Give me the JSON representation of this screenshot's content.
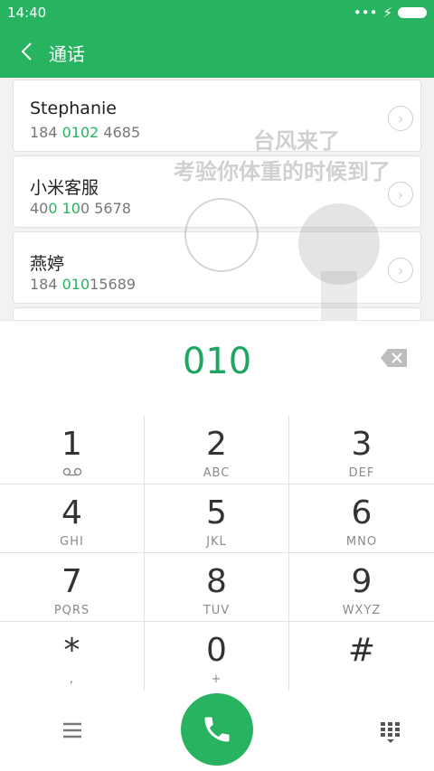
{
  "status_bar": {
    "time": "14:40"
  },
  "app_bar": {
    "title": "通话"
  },
  "contacts": [
    {
      "name": "Stephanie",
      "number_parts": [
        "184 ",
        "0102",
        " 4685"
      ]
    },
    {
      "name": "小米客服",
      "number_parts": [
        "40",
        "0 10",
        "0 5678"
      ]
    },
    {
      "name": "燕婷",
      "number_parts": [
        "184 ",
        "010",
        "15689"
      ]
    }
  ],
  "watermark": {
    "line1": "台风来了",
    "line2": "考验你体重的时候到了"
  },
  "dialer": {
    "entered_number": "010"
  },
  "keypad": {
    "keys": [
      {
        "digit": "1",
        "letters": ""
      },
      {
        "digit": "2",
        "letters": "ABC"
      },
      {
        "digit": "3",
        "letters": "DEF"
      },
      {
        "digit": "4",
        "letters": "GHI"
      },
      {
        "digit": "5",
        "letters": "JKL"
      },
      {
        "digit": "6",
        "letters": "MNO"
      },
      {
        "digit": "7",
        "letters": "PQRS"
      },
      {
        "digit": "8",
        "letters": "TUV"
      },
      {
        "digit": "9",
        "letters": "WXYZ"
      },
      {
        "digit": "*",
        "letters": ","
      },
      {
        "digit": "0",
        "letters": "+"
      },
      {
        "digit": "#",
        "letters": ""
      }
    ]
  },
  "colors": {
    "accent": "#27b35f",
    "number_text": "#1fa562"
  },
  "icons": [
    "back-arrow-icon",
    "chevron-right-icon",
    "backspace-icon",
    "voicemail-icon",
    "menu-icon",
    "phone-icon",
    "dialpad-icon"
  ]
}
